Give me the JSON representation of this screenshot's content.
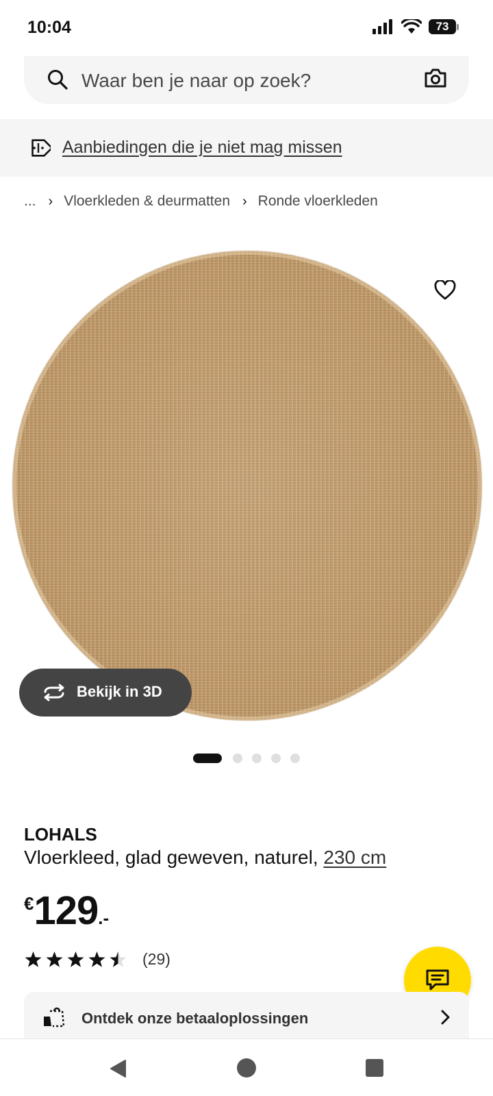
{
  "status_bar": {
    "time": "10:04",
    "battery": "73"
  },
  "search": {
    "placeholder": "Waar ben je naar op zoek?"
  },
  "offers": {
    "label": "Aanbiedingen die je niet mag missen"
  },
  "breadcrumb": {
    "items": [
      "...",
      "Vloerkleden & deurmatten",
      "Ronde vloerkleden"
    ]
  },
  "gallery": {
    "view_3d_label": "Bekijk in 3D",
    "dots_total": 5,
    "active_dot": 1
  },
  "product": {
    "name": "LOHALS",
    "description": "Vloerkleed, glad geweven, naturel, ",
    "size": "230 cm",
    "price_currency": "€",
    "price_amount": "129",
    "price_decimals": ".-",
    "rating": 4.5,
    "rating_max": 5,
    "review_count": "(29)"
  },
  "payment": {
    "label": "Ontdek onze betaaloplossingen"
  },
  "colors": {
    "chat_button": "#ffdb00",
    "view_3d_bg": "#444444",
    "banner_bg": "#f5f5f5"
  },
  "icons": {
    "search": "search-icon",
    "camera": "camera-icon",
    "offers": "price-tag-icon",
    "favorite": "heart-icon",
    "view_3d": "rotate-3d-icon",
    "chat": "chat-icon",
    "payment": "payment-icon",
    "chevron": "chevron-right-icon"
  }
}
